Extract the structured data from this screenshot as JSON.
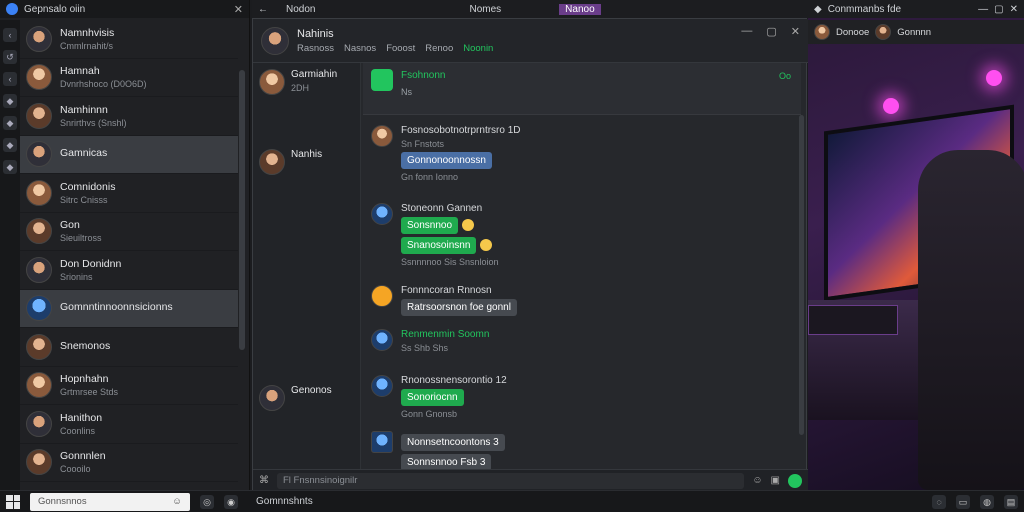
{
  "left_panel": {
    "title": "Gepnsalo oiin",
    "contacts": [
      {
        "name": "Namnhvisis",
        "sub": "Cmmlrnahit/s",
        "meta": ""
      },
      {
        "name": "Hamnah",
        "sub": "Dvnrhshoco (D0O6D)",
        "meta": ""
      },
      {
        "name": "Namhinnn",
        "sub": "Snrirthvs (Snshl)",
        "meta": ""
      },
      {
        "name": "Gamnicas",
        "sub": "",
        "meta": ""
      },
      {
        "name": "Comnidonis",
        "sub": "Sitrc Cnisss",
        "meta": ""
      },
      {
        "name": "Gon",
        "sub": "Sieuiltross",
        "meta": ""
      },
      {
        "name": "Don Donidnn",
        "sub": "Srionins",
        "meta": ""
      },
      {
        "name": "Gomnntinnoonnsicionns",
        "sub": "",
        "meta": ""
      },
      {
        "name": "Snemonos",
        "sub": "",
        "meta": ""
      },
      {
        "name": "Hopnhahn",
        "sub": "Grtmrsee Stds",
        "meta": ""
      },
      {
        "name": "Hanithon",
        "sub": "Coonlins",
        "meta": ""
      },
      {
        "name": "Gonnnlen",
        "sub": "Coooilo",
        "meta": ""
      }
    ]
  },
  "topbar": {
    "tabs": [
      "Nodon",
      "Nomes",
      "Nanoo"
    ]
  },
  "chat": {
    "name": "Nahinis",
    "tabs": [
      "Rasnoss",
      "Nasnos",
      "Fooost",
      "Renoo",
      "Noonin"
    ],
    "members": [
      {
        "name": "Garmiahin",
        "sub": "2DH"
      },
      {
        "name": "Nanhis",
        "sub": ""
      },
      {
        "name": "Genonos",
        "sub": ""
      }
    ],
    "pinned": {
      "title": "Fsohnonn",
      "sub": "Ns",
      "meta": "Oo"
    },
    "messages": [
      {
        "author": "Fosnosobotnotrprntrsro 1D",
        "meta": "Sn Fnstots",
        "bubble": "Gonnonoonnossn",
        "bubble_meta": "Gn fonn Ionno"
      },
      {
        "author": "Stoneonn Gannen",
        "meta": "Sonsnnoo",
        "bubble": "Snanosoinsnn",
        "bubble_meta": "Ssnnnnoo Sis Snsnloion"
      },
      {
        "author": "Fonnncoran Rnnosn",
        "meta": "Ratrsoorsnon foe gonnl",
        "bubble": "",
        "bubble_meta": ""
      },
      {
        "author": "Renmenmin Soomn",
        "meta": "Ss Shb Shs",
        "bubble": "",
        "bubble_meta": ""
      },
      {
        "author": "Rnonossnensorontio 12",
        "meta": "Gonn Gnonsb",
        "bubble": "Sonoriocnn",
        "bubble_meta": ""
      },
      {
        "author": "Nonnsetncoontons 3",
        "meta": "Sonnsnnoo Fsb 3",
        "bubble": "",
        "bubble_meta": ""
      }
    ],
    "composer_placeholder": "Fl Fnsnnsinoignilr"
  },
  "right_panel": {
    "title": "Conmmanbs fde",
    "contact_a": "Donooe",
    "contact_b": "Gonnnn"
  },
  "taskbar": {
    "search_placeholder": "Gonnsnnos",
    "app_label": "Gomnnshnts"
  },
  "colors": {
    "accent_green": "#22c55e",
    "accent_blue": "#4a6fa5",
    "bg_dark": "#202124"
  }
}
